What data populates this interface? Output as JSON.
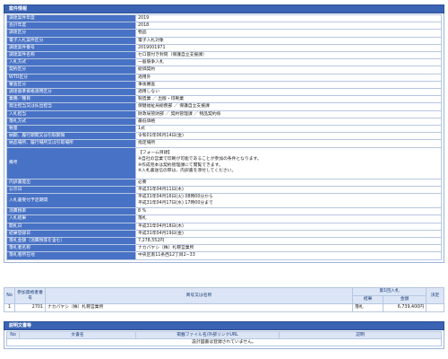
{
  "case_panel": {
    "title": "案件情報",
    "rows": [
      {
        "key": "調達案件年度",
        "value": "2019"
      },
      {
        "key": "会計年度",
        "value": "2018"
      },
      {
        "key": "調達区分",
        "value": "物品"
      },
      {
        "key": "電子入札案件区分",
        "value": "電子入札対象"
      },
      {
        "key": "調達案件番号",
        "value": "2019001971"
      },
      {
        "key": "調達案件名称",
        "value": "セロ雷付き封筒（保護自立支援課）"
      },
      {
        "key": "入札方式",
        "value": "一般競争入札"
      },
      {
        "key": "契約区分",
        "value": "総価契約"
      },
      {
        "key": "WTO区分",
        "value": "適用外"
      },
      {
        "key": "審査区分",
        "value": "事後審査"
      },
      {
        "key": "調達基準価格適用区分",
        "value": "適用しない"
      },
      {
        "key": "業種／種目",
        "value": "製造業 ／ 出版・印刷業"
      },
      {
        "key": "発注担当又は払出担当",
        "value": "保健福祉局総務部 ／ 保護自立支援課"
      },
      {
        "key": "入札担当",
        "value": "財政局管財部 ／ 契約管理課 ／ 物品契約係"
      },
      {
        "key": "落札方式",
        "value": "最低価格"
      },
      {
        "key": "数量",
        "value": "1式"
      },
      {
        "key": "納期、履行期間又は引取期限",
        "value": "令和01年06月14日(金)"
      },
      {
        "key": "納品場所、履行場所又は引取場所",
        "value": "指定場所"
      }
    ],
    "remarks": {
      "key": "備考",
      "lines": [
        "【フォーム目録】",
        "※自社の営業で印刷が可能であることが参加の条件となります。",
        "※作成見本は契約管理課にて閲覧できます。",
        "※入札書送信の際は、内訳書を添付してください。"
      ]
    },
    "rows2": [
      {
        "key": "内訳書提出",
        "value": "必要"
      },
      {
        "key": "公示日",
        "value": "平成31年04月11日(木)"
      }
    ],
    "period": {
      "key": "入札書受付予定期間",
      "lines": [
        "平成31年04月16日(火) 08時00分から",
        "平成31年04月17日(水) 17時00分まで"
      ]
    },
    "rows3": [
      {
        "key": "消費税率",
        "value": "8 %"
      },
      {
        "key": "入札結果",
        "value": "落札"
      },
      {
        "key": "開札日",
        "value": "平成31年04月18日(木)"
      },
      {
        "key": "結果登録日",
        "value": "平成31年04月19日(金)"
      },
      {
        "key": "落札金額（消費税等を含む）",
        "value": "7,278,552円"
      },
      {
        "key": "落札者名称",
        "value": "ナカバヤシ（株）札幌営業所"
      },
      {
        "key": "落札者所在地",
        "value": "中央区南11条西12丁目2−33"
      }
    ]
  },
  "bid_table": {
    "headers": {
      "no": "No",
      "reg_no": "参加資格者番号",
      "name": "商号又は名称",
      "round": "第1回入札",
      "result": "結果",
      "amount": "金額",
      "decision": "決定"
    },
    "rows": [
      {
        "no": "1",
        "reg_no": "2701",
        "name": "ナカバヤシ（株）札幌営業所",
        "result": "落札",
        "amount": "6,739,400円",
        "decision": ""
      }
    ]
  },
  "doc_panel": {
    "title": "説明文書等",
    "headers": {
      "no": "No",
      "doc_name": "文書名",
      "link": "掲載ファイル名/外部リンクURL",
      "desc": "説明"
    },
    "empty_message": "設計図書は登録されていません。"
  }
}
